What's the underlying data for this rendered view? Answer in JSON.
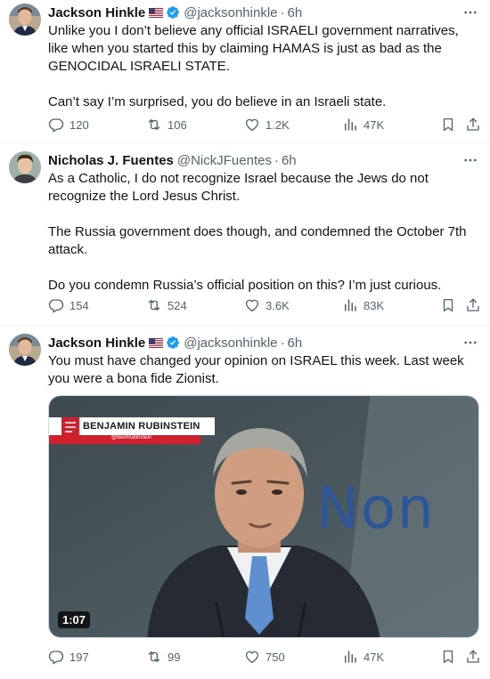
{
  "tweets": [
    {
      "author_name": "Jackson Hinkle",
      "handle": "@jacksonhinkle",
      "dot": "·",
      "time": "6h",
      "paragraphs": [
        "Unlike you I don’t believe any official ISRAELI government narratives, like when you started this by claiming HAMAS is just as bad as the GENOCIDAL ISRAELI STATE.",
        "Can’t say I’m surprised, you do believe in an Israeli state."
      ],
      "replies": "120",
      "reposts": "106",
      "likes": "1.2K",
      "views": "47K",
      "flag_icon": "us-flag-icon",
      "verified": true
    },
    {
      "author_name": "Nicholas J. Fuentes",
      "handle": "@NickJFuentes",
      "dot": "·",
      "time": "6h",
      "paragraphs": [
        "As a Catholic, I do not recognize Israel because the Jews do not recognize the Lord Jesus Christ.",
        "The Russia government does though, and condemned the October 7th attack.",
        "Do you condemn Russia’s official position on this? I’m just curious."
      ],
      "replies": "154",
      "reposts": "524",
      "likes": "3.6K",
      "views": "83K",
      "verified": false
    },
    {
      "author_name": "Jackson Hinkle",
      "handle": "@jacksonhinkle",
      "dot": "·",
      "time": "6h",
      "paragraphs": [
        "You must have changed your opinion on ISRAEL this week. Last week you were a bona fide Zionist."
      ],
      "replies": "197",
      "reposts": "99",
      "likes": "750",
      "views": "47K",
      "flag_icon": "us-flag-icon",
      "verified": true,
      "video": {
        "duration": "1:07",
        "chyron_name": "BENJAMIN RUBINSTEIN",
        "chyron_handle": "@BenRubinstein",
        "backdrop_text": "Non"
      }
    }
  ],
  "colors": {
    "text": "#0f1419",
    "secondary": "#536471",
    "verified_blue": "#1d9bf0",
    "divider": "#eff3f4"
  },
  "icons": [
    "more-icon",
    "reply-icon",
    "repost-icon",
    "like-icon",
    "views-icon",
    "bookmark-icon",
    "share-icon",
    "verified-badge-icon",
    "us-flag-icon"
  ]
}
